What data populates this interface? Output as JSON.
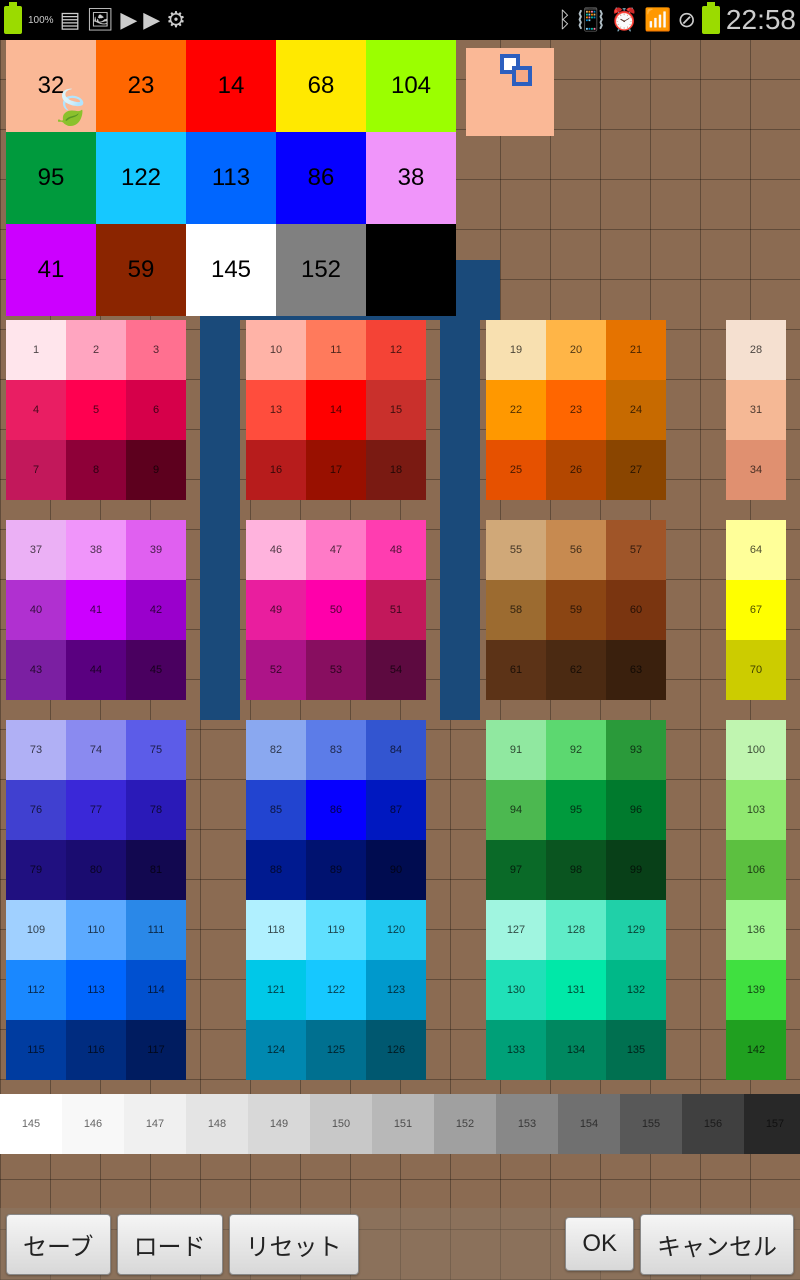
{
  "status": {
    "battery_pct": "100%",
    "clock": "22:58"
  },
  "tool": {
    "name": "layer-stack"
  },
  "top_palette": [
    {
      "n": "32",
      "c": "#FAB896",
      "leaf": true
    },
    {
      "n": "23",
      "c": "#FF6600"
    },
    {
      "n": "14",
      "c": "#FF0000"
    },
    {
      "n": "68",
      "c": "#FFE900"
    },
    {
      "n": "104",
      "c": "#9BFF00"
    },
    {
      "n": "95",
      "c": "#009A3D"
    },
    {
      "n": "122",
      "c": "#16C8FF"
    },
    {
      "n": "113",
      "c": "#0066FF"
    },
    {
      "n": "86",
      "c": "#0600FF"
    },
    {
      "n": "38",
      "c": "#F095FA"
    },
    {
      "n": "41",
      "c": "#CC00FF"
    },
    {
      "n": "59",
      "c": "#8B2500"
    },
    {
      "n": "145",
      "c": "#FFFFFF",
      "tc": "#000"
    },
    {
      "n": "152",
      "c": "#808080"
    },
    {
      "n": "",
      "c": "#000000"
    }
  ],
  "sub_rows": [
    [
      {
        "cells": [
          [
            "1",
            "#FFE5EC"
          ],
          [
            "2",
            "#FFA5C0"
          ],
          [
            "3",
            "#FF7090"
          ],
          [
            "4",
            "#E91E63"
          ],
          [
            "5",
            "#FF0050"
          ],
          [
            "6",
            "#D6004A"
          ],
          [
            "7",
            "#C2185B"
          ],
          [
            "8",
            "#8E0038"
          ],
          [
            "9",
            "#5D001E"
          ]
        ]
      },
      {
        "cells": [
          [
            "10",
            "#FFB3A7"
          ],
          [
            "11",
            "#FF7A5C"
          ],
          [
            "12",
            "#F44336"
          ],
          [
            "13",
            "#FF4D3D"
          ],
          [
            "14",
            "#FF0000"
          ],
          [
            "15",
            "#C9302C"
          ],
          [
            "16",
            "#B71C1C"
          ],
          [
            "17",
            "#991000"
          ],
          [
            "18",
            "#7A1A12"
          ]
        ]
      },
      {
        "cells": [
          [
            "19",
            "#F8E0B0"
          ],
          [
            "20",
            "#FFB547"
          ],
          [
            "21",
            "#E57300"
          ],
          [
            "22",
            "#FF9800"
          ],
          [
            "23",
            "#FF6600"
          ],
          [
            "24",
            "#C76A00"
          ],
          [
            "25",
            "#E65100"
          ],
          [
            "26",
            "#B34700"
          ],
          [
            "27",
            "#8A4500"
          ]
        ]
      },
      {
        "last": true,
        "cells": [
          [
            "28",
            "#F5E0D0"
          ],
          [
            "31",
            "#F5B895"
          ],
          [
            "34",
            "#E09070"
          ]
        ]
      }
    ],
    [
      {
        "cells": [
          [
            "37",
            "#EBB0F5"
          ],
          [
            "38",
            "#F095FA"
          ],
          [
            "39",
            "#E060F0"
          ],
          [
            "40",
            "#B030D0"
          ],
          [
            "41",
            "#CC00FF"
          ],
          [
            "42",
            "#9A00CC"
          ],
          [
            "43",
            "#7B1FA2"
          ],
          [
            "44",
            "#5A0080"
          ],
          [
            "45",
            "#4A0060"
          ]
        ]
      },
      {
        "cells": [
          [
            "46",
            "#FFB3DD"
          ],
          [
            "47",
            "#FF7AC7"
          ],
          [
            "48",
            "#FF3DB0"
          ],
          [
            "49",
            "#E91E9E"
          ],
          [
            "50",
            "#FF00AA"
          ],
          [
            "51",
            "#C2185B"
          ],
          [
            "52",
            "#AD1488"
          ],
          [
            "53",
            "#880E60"
          ],
          [
            "54",
            "#5D0A40"
          ]
        ]
      },
      {
        "cells": [
          [
            "55",
            "#D0A878"
          ],
          [
            "56",
            "#C78A50"
          ],
          [
            "57",
            "#A05528"
          ],
          [
            "58",
            "#9C6B30"
          ],
          [
            "59",
            "#8B4513"
          ],
          [
            "60",
            "#7A3510"
          ],
          [
            "61",
            "#5C3317"
          ],
          [
            "62",
            "#4B2A12"
          ],
          [
            "63",
            "#3A200D"
          ]
        ]
      },
      {
        "last": true,
        "cells": [
          [
            "64",
            "#FFFF99"
          ],
          [
            "67",
            "#FFFF00"
          ],
          [
            "70",
            "#CCCC00"
          ]
        ]
      }
    ],
    [
      {
        "cells": [
          [
            "73",
            "#B0B0F5"
          ],
          [
            "74",
            "#8A8AF0"
          ],
          [
            "75",
            "#5C5CE8"
          ],
          [
            "76",
            "#4040D0"
          ],
          [
            "77",
            "#3A28D8"
          ],
          [
            "78",
            "#2A1AB8"
          ],
          [
            "79",
            "#201080"
          ],
          [
            "80",
            "#1A0C70"
          ],
          [
            "81",
            "#120850"
          ]
        ]
      },
      {
        "cells": [
          [
            "82",
            "#8AA8F0"
          ],
          [
            "83",
            "#5C7CE8"
          ],
          [
            "84",
            "#3355D0"
          ],
          [
            "85",
            "#2244D0"
          ],
          [
            "86",
            "#0600FF"
          ],
          [
            "87",
            "#0018C0"
          ],
          [
            "88",
            "#001A90"
          ],
          [
            "89",
            "#001270"
          ],
          [
            "90",
            "#000C50"
          ]
        ]
      },
      {
        "cells": [
          [
            "91",
            "#90E8A0"
          ],
          [
            "92",
            "#5CD870"
          ],
          [
            "93",
            "#2A9A3A"
          ],
          [
            "94",
            "#4CB850"
          ],
          [
            "95",
            "#009A3D"
          ],
          [
            "96",
            "#007A2D"
          ],
          [
            "97",
            "#0A6A28"
          ],
          [
            "98",
            "#0A5520"
          ],
          [
            "99",
            "#084018"
          ]
        ]
      },
      {
        "last": true,
        "cells": [
          [
            "100",
            "#C0F5B0"
          ],
          [
            "103",
            "#90E870"
          ],
          [
            "106",
            "#5CC040"
          ]
        ]
      }
    ],
    [
      {
        "cells": [
          [
            "109",
            "#A0D0FF"
          ],
          [
            "110",
            "#5CAAFF"
          ],
          [
            "111",
            "#2A88E8"
          ],
          [
            "112",
            "#1A88FF"
          ],
          [
            "113",
            "#0066FF"
          ],
          [
            "114",
            "#0050D0"
          ],
          [
            "115",
            "#003CA0"
          ],
          [
            "116",
            "#002C80"
          ],
          [
            "117",
            "#001C60"
          ]
        ]
      },
      {
        "cells": [
          [
            "118",
            "#B0F0FF"
          ],
          [
            "119",
            "#60E0FF"
          ],
          [
            "120",
            "#20C8F0"
          ],
          [
            "121",
            "#00C8E8"
          ],
          [
            "122",
            "#16C8FF"
          ],
          [
            "123",
            "#0099CC"
          ],
          [
            "124",
            "#0088B0"
          ],
          [
            "125",
            "#007090"
          ],
          [
            "126",
            "#005870"
          ]
        ]
      },
      {
        "cells": [
          [
            "127",
            "#A0F5E0"
          ],
          [
            "128",
            "#60ECC8"
          ],
          [
            "129",
            "#20D0A8"
          ],
          [
            "130",
            "#20E0B8"
          ],
          [
            "131",
            "#00E8A8"
          ],
          [
            "132",
            "#00B888"
          ],
          [
            "133",
            "#00A078"
          ],
          [
            "134",
            "#008860"
          ],
          [
            "135",
            "#007050"
          ]
        ]
      },
      {
        "last": true,
        "cells": [
          [
            "136",
            "#A0F590"
          ],
          [
            "139",
            "#40E040"
          ],
          [
            "142",
            "#20A020"
          ]
        ]
      }
    ]
  ],
  "grad": [
    [
      "145",
      "#FFFFFF"
    ],
    [
      "146",
      "#F8F8F8"
    ],
    [
      "147",
      "#F0F0F0"
    ],
    [
      "148",
      "#E4E4E4"
    ],
    [
      "149",
      "#D8D8D8"
    ],
    [
      "150",
      "#C8C8C8"
    ],
    [
      "151",
      "#B8B8B8"
    ],
    [
      "152",
      "#A0A0A0"
    ],
    [
      "153",
      "#888888"
    ],
    [
      "154",
      "#707070"
    ],
    [
      "155",
      "#585858"
    ],
    [
      "156",
      "#404040"
    ],
    [
      "157",
      "#282828"
    ]
  ],
  "buttons": {
    "save": "セーブ",
    "load": "ロード",
    "reset": "リセット",
    "ok": "OK",
    "cancel": "キャンセル"
  }
}
